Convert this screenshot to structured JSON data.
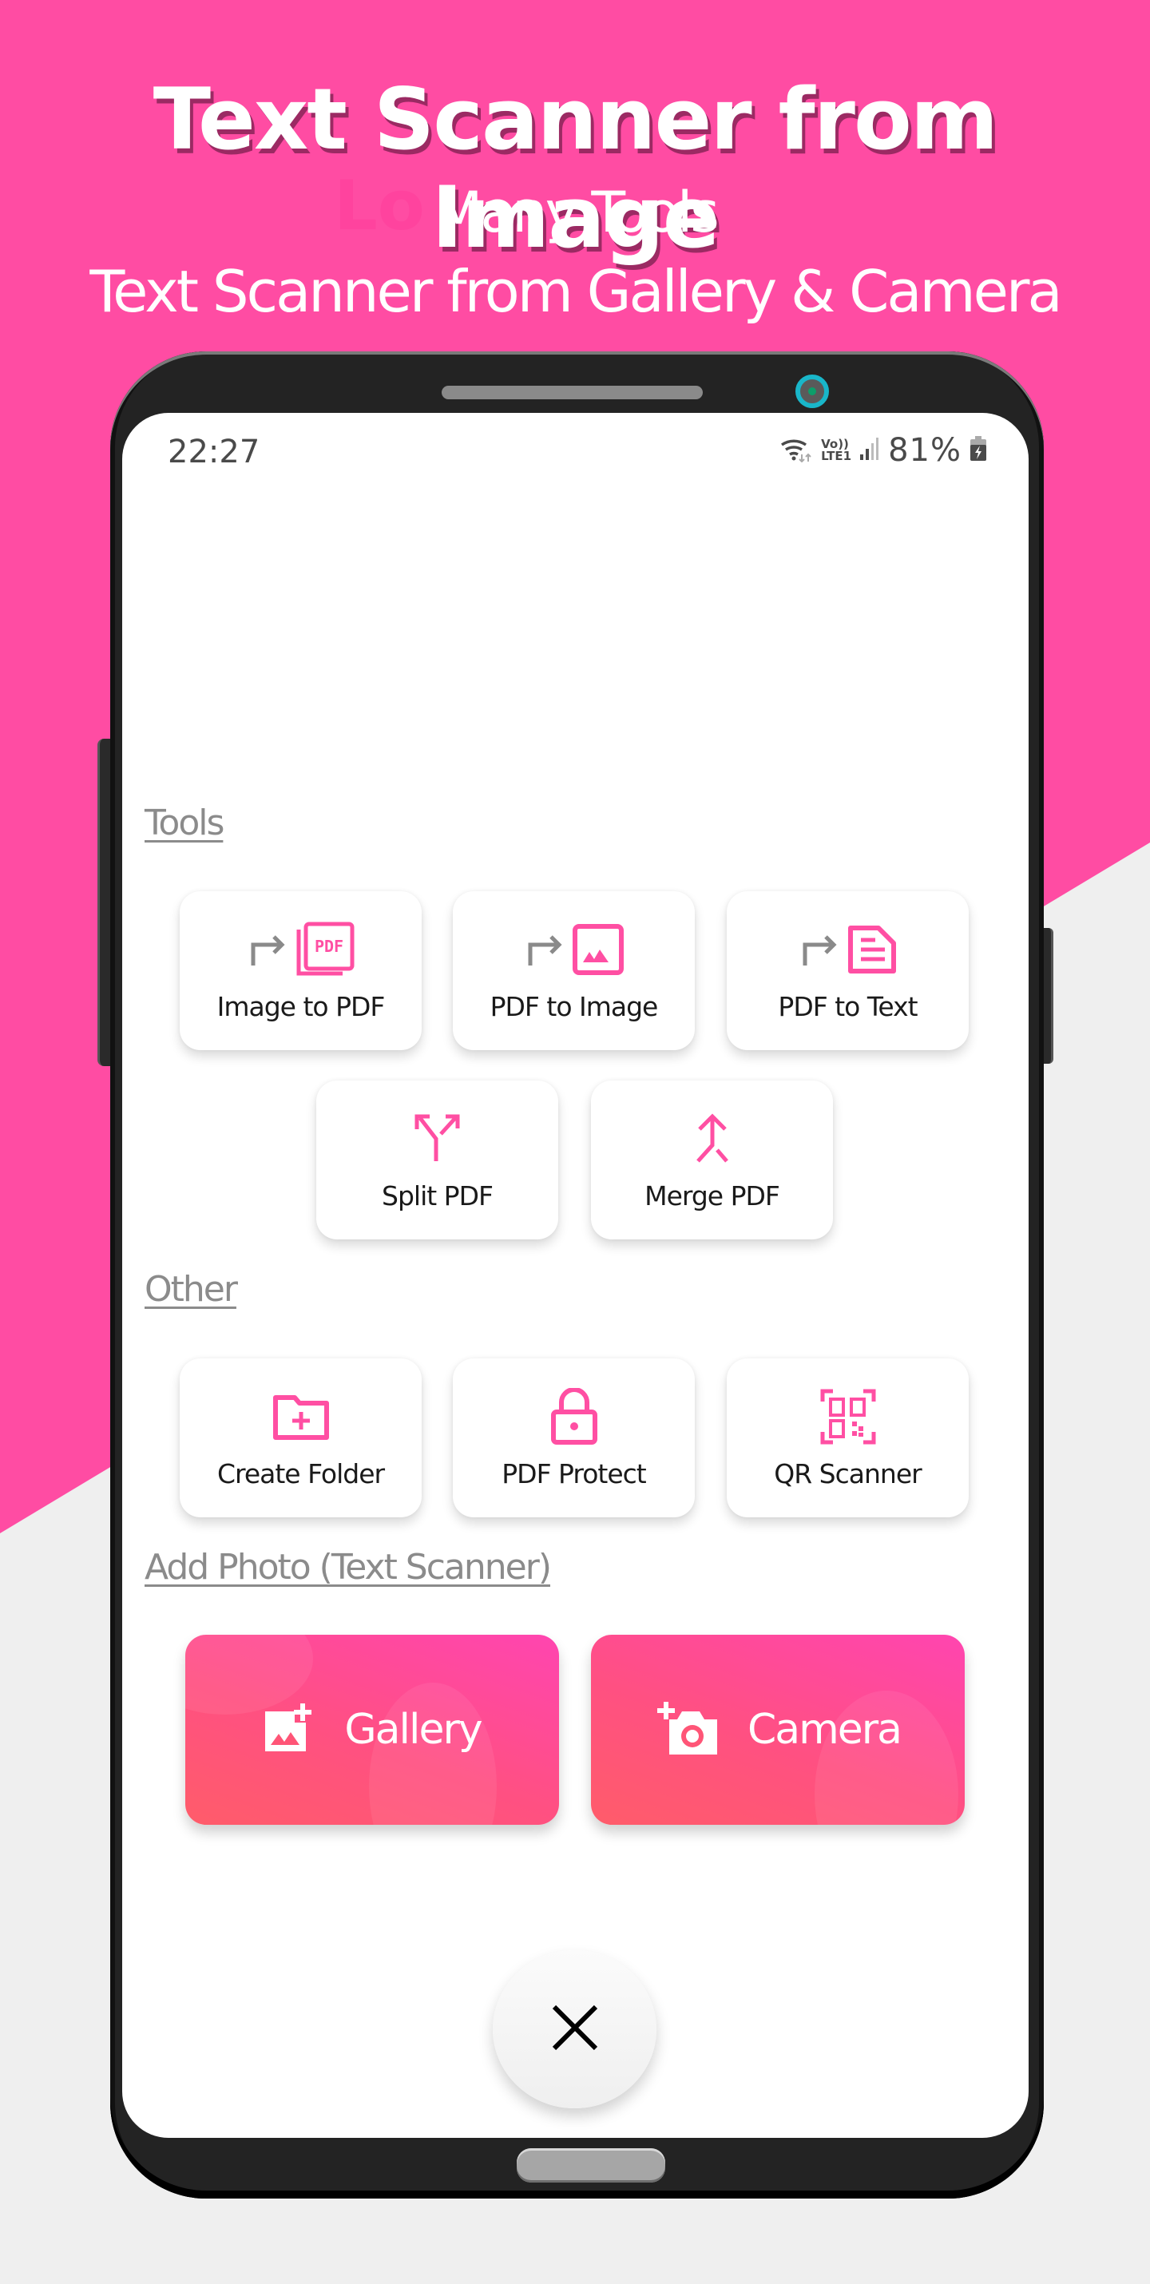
{
  "promo": {
    "title": "Text Scanner from Image",
    "ghost_text": "Lo",
    "subtitle_1": "Many Tools",
    "subtitle_2": "Text Scanner from Gallery & Camera"
  },
  "status_bar": {
    "time": "22:27",
    "network_top": "Vo))",
    "network_bottom": "LTE1",
    "battery_percent": "81%",
    "icons": [
      "wifi-icon",
      "signal-icon",
      "battery-charging-icon"
    ]
  },
  "sections": {
    "tools": {
      "heading": "Tools",
      "items": [
        {
          "label": "Image to PDF",
          "icon": "image-to-pdf-icon"
        },
        {
          "label": "PDF to Image",
          "icon": "pdf-to-image-icon"
        },
        {
          "label": "PDF to Text",
          "icon": "pdf-to-text-icon"
        },
        {
          "label": "Split PDF",
          "icon": "split-icon"
        },
        {
          "label": "Merge PDF",
          "icon": "merge-icon"
        }
      ]
    },
    "other": {
      "heading": "Other",
      "items": [
        {
          "label": "Create Folder",
          "icon": "create-folder-icon"
        },
        {
          "label": "PDF Protect",
          "icon": "lock-icon"
        },
        {
          "label": "QR Scanner",
          "icon": "qr-scanner-icon"
        }
      ]
    },
    "add_photo": {
      "heading": "Add Photo (Text Scanner)",
      "buttons": [
        {
          "label": "Gallery",
          "icon": "add-photo-icon"
        },
        {
          "label": "Camera",
          "icon": "add-camera-icon"
        }
      ]
    }
  },
  "close_button": {
    "icon": "close-icon"
  },
  "colors": {
    "brand_pink": "#ff4ca3",
    "icon_pink": "#ff4fa3",
    "arrow_gray": "#8a8a8a",
    "heading_gray": "#8b8b8b",
    "button_gradient_start": "#ff5c6a",
    "button_gradient_end": "#ff45b0"
  }
}
